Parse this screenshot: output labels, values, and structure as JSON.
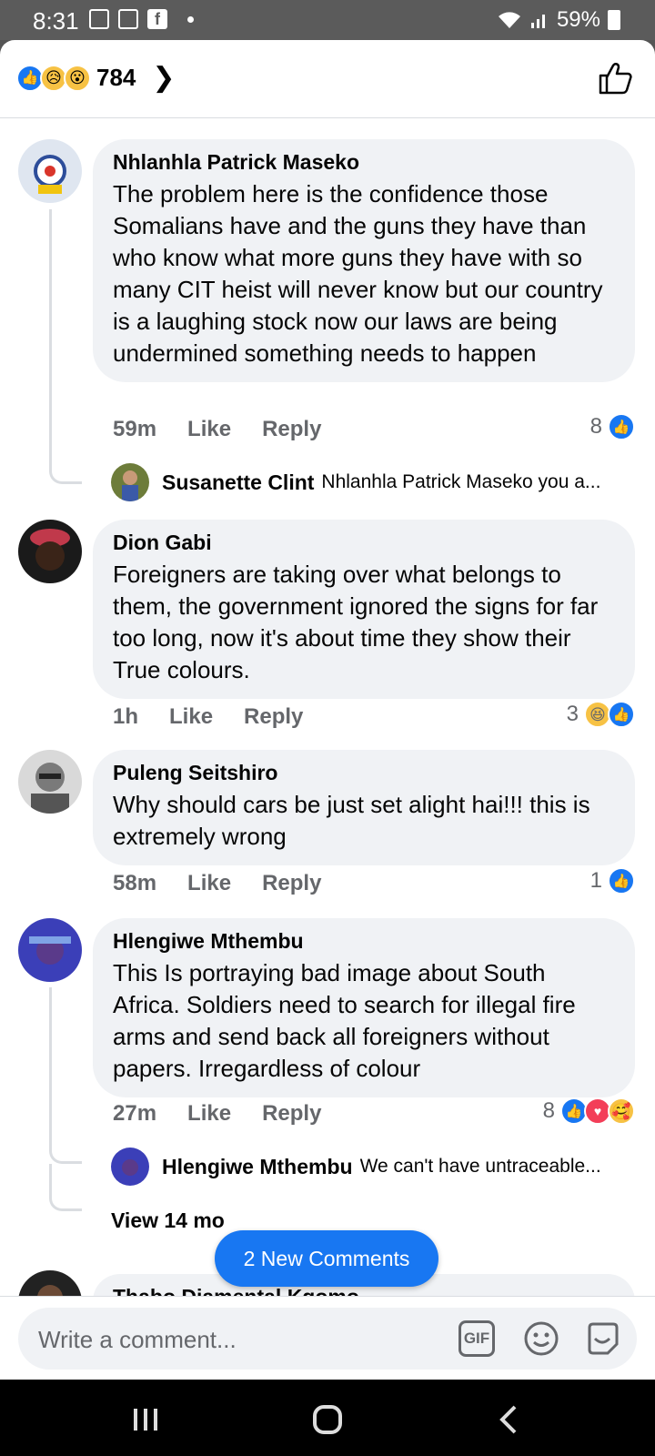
{
  "status_bar": {
    "time": "8:31",
    "battery": "59%"
  },
  "header": {
    "reaction_count": "784",
    "reaction_icons": [
      "like-icon",
      "sad-icon",
      "wow-icon"
    ]
  },
  "comments": [
    {
      "name": "Nhlanhla Patrick Maseko",
      "text": "The problem here is the confidence those Somalians have and the guns they have than who know what more guns they have with so many CIT heist will never know but our country is a laughing stock now our laws are being undermined something needs to happen",
      "time": "59m",
      "like_label": "Like",
      "reply_label": "Reply",
      "reaction_count": "8",
      "reactions": [
        "like"
      ],
      "reply_preview": {
        "name": "Susanette Clint",
        "text": "Nhlanhla Patrick Maseko you a..."
      }
    },
    {
      "name": "Dion Gabi",
      "text": "Foreigners are taking over what  belongs to them, the government ignored the signs for far too long, now it's about time they show their True colours.",
      "time": "1h",
      "like_label": "Like",
      "reply_label": "Reply",
      "reaction_count": "3",
      "reactions": [
        "haha",
        "like"
      ]
    },
    {
      "name": "Puleng Seitshiro",
      "text": "Why should cars be just set alight hai!!! this is extremely wrong",
      "time": "58m",
      "like_label": "Like",
      "reply_label": "Reply",
      "reaction_count": "1",
      "reactions": [
        "like"
      ]
    },
    {
      "name": "Hlengiwe Mthembu",
      "text": "This Is portraying bad image about South Africa. Soldiers need to search for illegal fire arms and send back all foreigners without papers. Irregardless of colour",
      "time": "27m",
      "like_label": "Like",
      "reply_label": "Reply",
      "reaction_count": "8",
      "reactions": [
        "like",
        "love",
        "care"
      ],
      "reply_preview": {
        "name": "Hlengiwe Mthembu",
        "text": "We can't have untraceable..."
      },
      "view_more": "View 14 mo"
    }
  ],
  "next_comment_name": "Thabo Diamental Kgomo",
  "new_comments_pill": "2 New Comments",
  "composer": {
    "placeholder": "Write a comment...",
    "gif_label": "GIF"
  },
  "colors": {
    "brand_blue": "#1877f2",
    "bubble": "#f0f2f5",
    "muted_text": "#65676b"
  }
}
